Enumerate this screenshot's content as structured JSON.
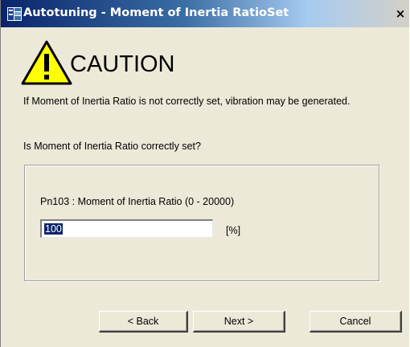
{
  "window": {
    "title": "Autotuning - Moment of Inertia RatioSet",
    "close_glyph": "×"
  },
  "caution": {
    "heading": "CAUTION",
    "message": "If Moment of Inertia Ratio is not correctly set, vibration may be generated.",
    "question": "Is Moment of Inertia Ratio correctly set?"
  },
  "parameter": {
    "label": "Pn103 : Moment of Inertia Ratio (0 - 20000)",
    "value": "100",
    "unit": "[%]"
  },
  "buttons": {
    "back_label": "< Back",
    "next_label": "Next >",
    "cancel_label": "Cancel"
  },
  "icons": {
    "app": "app-window-icon",
    "warning": "warning-triangle-icon",
    "close": "close-icon"
  },
  "colors": {
    "dialog_background": "#ece9d8",
    "title_gradient_start": "#0a246a",
    "title_gradient_end": "#d4d0c8",
    "warning_fill": "#ffff00",
    "selection_highlight": "#0a246a"
  }
}
